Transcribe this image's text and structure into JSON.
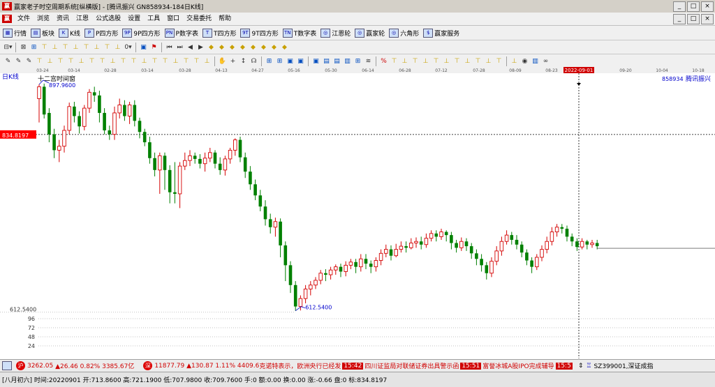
{
  "window": {
    "title": "赢家老子时空周期系统[纵横版] - [腾讯振兴  GN858934-184日K线]",
    "app_icon": "赢",
    "controls": [
      "_",
      "□",
      "×"
    ],
    "mdi_controls": [
      "_",
      "□",
      "×"
    ]
  },
  "menu": [
    "文件",
    "浏览",
    "资讯",
    "江恩",
    "公式选股",
    "设置",
    "工具",
    "窗口",
    "交易委托",
    "帮助"
  ],
  "toolbar1": [
    {
      "label": "行情",
      "icon": "grid-icon"
    },
    {
      "label": "板块",
      "icon": "blocks-icon"
    },
    {
      "label": "K线",
      "icon": "candle-icon"
    },
    {
      "label": "P四方形",
      "icon": "p-square-icon"
    },
    {
      "label": "9P四方形",
      "icon": "9p-square-icon"
    },
    {
      "label": "P数字表",
      "icon": "p-table-icon"
    },
    {
      "label": "T四方形",
      "icon": "t-square-icon"
    },
    {
      "label": "9T四方形",
      "icon": "9t-square-icon"
    },
    {
      "label": "T数字表",
      "icon": "t-table-icon"
    },
    {
      "label": "江恩轮",
      "icon": "gann-wheel-icon"
    },
    {
      "label": "赢家轮",
      "icon": "winner-wheel-icon"
    },
    {
      "label": "六角形",
      "icon": "hexagon-icon"
    },
    {
      "label": "赢家服务",
      "icon": "dollar-icon"
    }
  ],
  "toolbar1_icon_glyphs": [
    "▦",
    "▤",
    "K",
    "P",
    "9P",
    "PN",
    "T",
    "9T",
    "TN",
    "◎",
    "◎",
    "◎",
    "$"
  ],
  "toolbar2_glyphs": [
    "⊟▾",
    "⊠",
    "⊞",
    "⊤",
    "⊥",
    "⊤",
    "⊥",
    "⊤",
    "⊥",
    "⊤",
    "⊥",
    "0▾",
    "▣",
    "⚑",
    "⏮",
    "⏭",
    "◀",
    "▶",
    "◆",
    "◆",
    "◆",
    "◆",
    "◆",
    "◆",
    "◆",
    "◆"
  ],
  "toolbar3_glyphs": [
    "✎",
    "✎",
    "✎",
    "⊤",
    "⊥",
    "⊤",
    "⊤",
    "⊥",
    "⊤",
    "⊤",
    "⊥",
    "⊤",
    "⊤",
    "⊥",
    "⊤",
    "⊤",
    "⊥",
    "⊤",
    "⊤",
    "⊥",
    "✋",
    "+",
    "↕",
    "☊",
    "⊞",
    "⊞",
    "▣",
    "▣",
    "▣",
    "▤",
    "▤",
    "▥",
    "⊞",
    "≋",
    "%",
    "⊤",
    "⊥",
    "⊤",
    "⊥",
    "⊤",
    "⊥",
    "⊤",
    "⊥",
    "⊤",
    "⊥",
    "⊤",
    "⊥",
    "◉",
    "▥",
    "∞"
  ],
  "time_axis": {
    "labels": [
      "03-24",
      "03-14",
      "02-28",
      "03-14",
      "03-28",
      "04-13",
      "04-27",
      "05-16",
      "05-30",
      "06-14",
      "06-28",
      "07-12",
      "07-28",
      "08-09",
      "08-23",
      "2022-09-01",
      "09-20",
      "10-04",
      "10-18"
    ],
    "highlight": "2022-09-01"
  },
  "chart": {
    "period_label": "日K线",
    "code_label": "858934",
    "name_label": "腾讯振兴",
    "marker_label": "十二宫时间窗",
    "current_price_tag": "834.8197",
    "high_annot": "897.9600",
    "low_annot": "612.5400",
    "low_axis_label": "612.5400",
    "volume_ticks": [
      "96",
      "72",
      "48",
      "24"
    ],
    "colors": {
      "up": "#d40000",
      "down": "#008000",
      "annot": "#0000cc",
      "priceline": "#000000",
      "tag": "#ff0000"
    }
  },
  "chart_data": {
    "type": "candlestick",
    "title": "",
    "value_range": [
      600,
      905
    ],
    "highlighted_values": {
      "high": 897.96,
      "low": 612.54,
      "current_line": 834.8197
    },
    "candles": [
      [
        880,
        895,
        850,
        898
      ],
      [
        895,
        860,
        855,
        899
      ],
      [
        862,
        835,
        825,
        868
      ],
      [
        835,
        815,
        805,
        842
      ],
      [
        815,
        820,
        800,
        828
      ],
      [
        820,
        840,
        812,
        846
      ],
      [
        840,
        870,
        835,
        875
      ],
      [
        870,
        858,
        850,
        876
      ],
      [
        858,
        845,
        836,
        864
      ],
      [
        845,
        868,
        840,
        872
      ],
      [
        868,
        888,
        862,
        892
      ],
      [
        888,
        884,
        876,
        895
      ],
      [
        884,
        862,
        850,
        890
      ],
      [
        862,
        840,
        835,
        868
      ],
      [
        840,
        835,
        828,
        846
      ],
      [
        835,
        862,
        828,
        870
      ],
      [
        862,
        872,
        855,
        880
      ],
      [
        872,
        858,
        852,
        878
      ],
      [
        858,
        872,
        848,
        876
      ],
      [
        872,
        852,
        845,
        878
      ],
      [
        852,
        838,
        830,
        856
      ],
      [
        838,
        825,
        820,
        842
      ],
      [
        825,
        805,
        798,
        832
      ],
      [
        805,
        790,
        782,
        812
      ],
      [
        790,
        808,
        760,
        812
      ],
      [
        808,
        790,
        765,
        812
      ],
      [
        790,
        762,
        748,
        796
      ],
      [
        762,
        760,
        748,
        800
      ],
      [
        760,
        795,
        742,
        800
      ],
      [
        795,
        802,
        790,
        812
      ],
      [
        802,
        808,
        795,
        815
      ],
      [
        808,
        804,
        798,
        812
      ],
      [
        804,
        798,
        792,
        810
      ],
      [
        798,
        805,
        788,
        812
      ],
      [
        805,
        812,
        800,
        818
      ],
      [
        812,
        798,
        792,
        815
      ],
      [
        798,
        790,
        784,
        806
      ],
      [
        790,
        804,
        783,
        808
      ],
      [
        804,
        815,
        798,
        818
      ],
      [
        815,
        828,
        808,
        830
      ],
      [
        828,
        806,
        800,
        832
      ],
      [
        806,
        788,
        780,
        812
      ],
      [
        788,
        772,
        765,
        795
      ],
      [
        772,
        758,
        752,
        778
      ],
      [
        758,
        744,
        738,
        765
      ],
      [
        744,
        728,
        720,
        752
      ],
      [
        728,
        718,
        710,
        735
      ],
      [
        718,
        725,
        706,
        730
      ],
      [
        725,
        695,
        680,
        729
      ],
      [
        695,
        670,
        650,
        700
      ],
      [
        670,
        645,
        635,
        675
      ],
      [
        645,
        618,
        612.54,
        650
      ],
      [
        618,
        628,
        613,
        632
      ],
      [
        628,
        640,
        622,
        645
      ],
      [
        640,
        645,
        632,
        650
      ],
      [
        645,
        651,
        640,
        655
      ],
      [
        651,
        660,
        646,
        664
      ],
      [
        660,
        658,
        650,
        665
      ],
      [
        658,
        664,
        652,
        668
      ],
      [
        664,
        668,
        658,
        671
      ],
      [
        668,
        662,
        655,
        672
      ],
      [
        662,
        670,
        656,
        675
      ],
      [
        670,
        674,
        665,
        678
      ],
      [
        674,
        668,
        660,
        678
      ],
      [
        668,
        678,
        662,
        684
      ],
      [
        678,
        672,
        665,
        684
      ],
      [
        672,
        668,
        660,
        676
      ],
      [
        668,
        676,
        662,
        680
      ],
      [
        676,
        685,
        670,
        690
      ],
      [
        685,
        690,
        680,
        696
      ],
      [
        690,
        682,
        676,
        695
      ],
      [
        682,
        690,
        680,
        697
      ],
      [
        690,
        694,
        686,
        700
      ],
      [
        694,
        692,
        686,
        700
      ],
      [
        692,
        698,
        690,
        704
      ],
      [
        698,
        700,
        692,
        705
      ],
      [
        700,
        696,
        690,
        706
      ],
      [
        696,
        704,
        692,
        710
      ],
      [
        704,
        710,
        700,
        714
      ],
      [
        710,
        706,
        700,
        714
      ],
      [
        706,
        712,
        702,
        716
      ],
      [
        712,
        708,
        700,
        714
      ],
      [
        708,
        698,
        690,
        712
      ],
      [
        698,
        692,
        686,
        702
      ],
      [
        692,
        700,
        688,
        705
      ],
      [
        700,
        694,
        688,
        704
      ],
      [
        694,
        685,
        678,
        698
      ],
      [
        685,
        678,
        670,
        690
      ],
      [
        678,
        670,
        662,
        684
      ],
      [
        670,
        660,
        652,
        674
      ],
      [
        660,
        675,
        655,
        680
      ],
      [
        675,
        688,
        670,
        694
      ],
      [
        688,
        700,
        682,
        706
      ],
      [
        700,
        708,
        696,
        714
      ],
      [
        708,
        702,
        696,
        712
      ],
      [
        702,
        696,
        690,
        708
      ],
      [
        696,
        686,
        680,
        700
      ],
      [
        686,
        676,
        670,
        690
      ],
      [
        676,
        668,
        660,
        680
      ],
      [
        668,
        680,
        664,
        684
      ],
      [
        680,
        690,
        675,
        695
      ],
      [
        690,
        700,
        685,
        706
      ],
      [
        700,
        712,
        695,
        718
      ],
      [
        712,
        718,
        706,
        722
      ],
      [
        718,
        716,
        710,
        722
      ],
      [
        716,
        706,
        700,
        720
      ],
      [
        706,
        700,
        694,
        710
      ],
      [
        700,
        693,
        688,
        704
      ],
      [
        693,
        700,
        690,
        704
      ],
      [
        700,
        696,
        690,
        702
      ],
      [
        696,
        698,
        692,
        702
      ],
      [
        698,
        694,
        690,
        702
      ]
    ]
  },
  "ticker": {
    "sh_icon": "沪",
    "sh_price": "3262.05",
    "sh_change": "▲26.46 0.82% 3385.67亿",
    "sz_icon": "深",
    "sz_price": "11877.79",
    "sz_change": "▲130.87 1.11% 4409.6",
    "news1": "克诺特表示，欧洲央行已经发",
    "time1": "15:42",
    "news2": "四川证监局对联储证券出具警示函",
    "time2": "15:51",
    "news3": "富誉冰城A股IPO完成辅导",
    "time3": "15:5",
    "right_code": "SZ399001,深证成指"
  },
  "status": {
    "text": "[八月初六] 时间:20220901 开:713.8600 高:721.1900 低:707.9800 收:709.7600 手:0 额:0.00 换:0.00 涨:-0.66 盘:0 标:834.8197"
  }
}
